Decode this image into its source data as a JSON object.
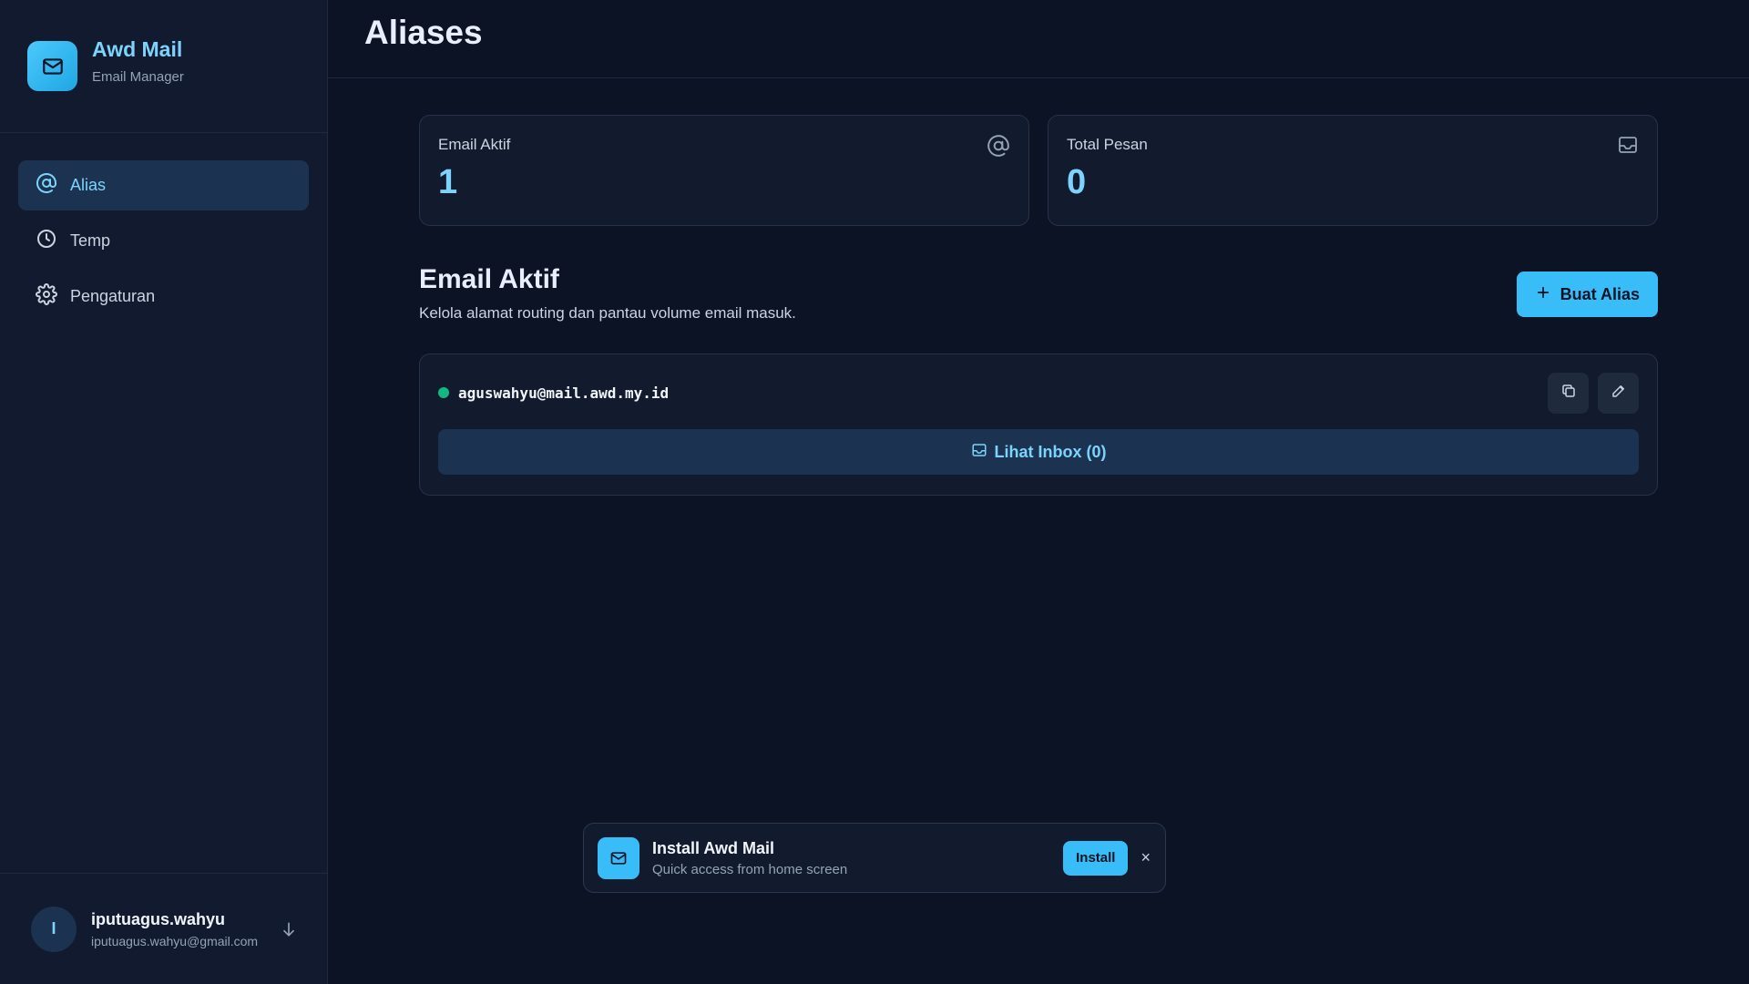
{
  "brand": {
    "name": "Awd Mail",
    "subtitle": "Email Manager"
  },
  "sidebar": {
    "items": [
      {
        "label": "Alias",
        "icon": "at-sign-icon",
        "active": true
      },
      {
        "label": "Temp",
        "icon": "clock-icon",
        "active": false
      },
      {
        "label": "Pengaturan",
        "icon": "gear-icon",
        "active": false
      }
    ]
  },
  "user": {
    "initial": "I",
    "name": "iputuagus.wahyu",
    "email": "iputuagus.wahyu@gmail.com",
    "action_icon": "arrow-down-icon"
  },
  "header": {
    "title": "Aliases"
  },
  "stats": [
    {
      "label": "Email Aktif",
      "value": "1",
      "icon": "at-sign-icon"
    },
    {
      "label": "Total Pesan",
      "value": "0",
      "icon": "inbox-icon"
    }
  ],
  "section": {
    "title": "Email Aktif",
    "description": "Kelola alamat routing dan pantau volume email masuk.",
    "create_button": "Buat Alias"
  },
  "aliases": [
    {
      "address": "aguswahyu@mail.awd.my.id",
      "status": "active",
      "inbox_label": "Lihat Inbox (0)"
    }
  ],
  "install": {
    "title": "Install Awd Mail",
    "subtitle": "Quick access from home screen",
    "button": "Install",
    "close": "×"
  },
  "colors": {
    "accent": "#38bdf8",
    "accent_text": "#7dd3fc",
    "background": "#0b1324",
    "status_active": "#10b981"
  }
}
